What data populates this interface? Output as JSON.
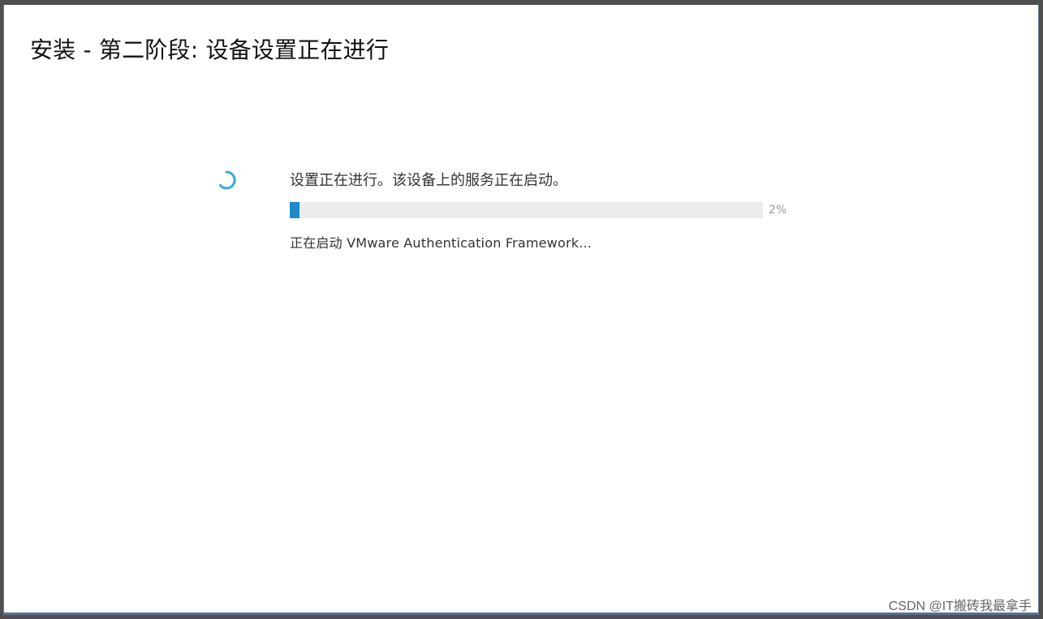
{
  "dialog": {
    "title": "安装 - 第二阶段: 设备设置正在进行"
  },
  "progress": {
    "status_text": "设置正在进行。该设备上的服务正在启动。",
    "percent_value": 2,
    "percent_label": "2%",
    "detail_text": "正在启动 VMware Authentication Framework..."
  },
  "icons": {
    "spinner": "loading-spinner-icon"
  },
  "colors": {
    "accent": "#1d8ac9",
    "spinner": "#38a9e0",
    "track": "#ececec"
  },
  "watermark": {
    "text": "CSDN @IT搬砖我最拿手"
  }
}
